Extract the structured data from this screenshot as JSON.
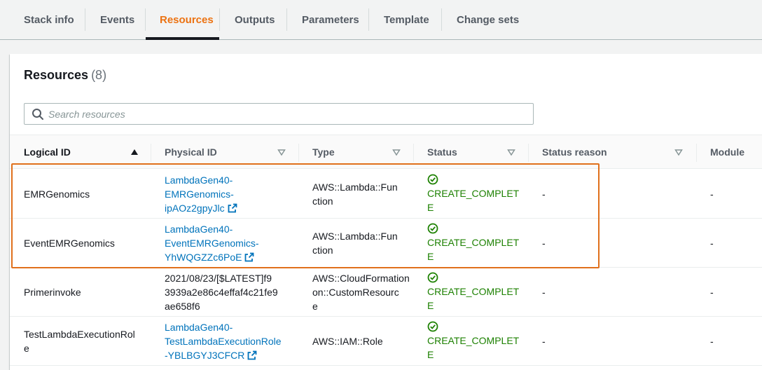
{
  "tabs": [
    "Stack info",
    "Events",
    "Resources",
    "Outputs",
    "Parameters",
    "Template",
    "Change sets"
  ],
  "active_tab": "Resources",
  "panel": {
    "title": "Resources",
    "count": "(8)"
  },
  "search": {
    "placeholder": "Search resources",
    "value": ""
  },
  "columns": [
    "Logical ID",
    "Physical ID",
    "Type",
    "Status",
    "Status reason",
    "Module"
  ],
  "sort": {
    "column": "Logical ID",
    "direction": "ascending"
  },
  "rows": [
    {
      "logical_id": "EMRGenomics",
      "physical_id_lines": [
        "LambdaGen40-",
        "EMRGenomics-",
        "ipAOz2gpyJlc"
      ],
      "physical_is_link": true,
      "type_lines": [
        "AWS::Lambda::Fun",
        "ction"
      ],
      "status_lines": [
        "CREATE_COMPLET",
        "E"
      ],
      "status_reason": "-",
      "module": "-"
    },
    {
      "logical_id": "EventEMRGenomics",
      "physical_id_lines": [
        "LambdaGen40-",
        "EventEMRGenomics-",
        "YhWQGZZc6PoE"
      ],
      "physical_is_link": true,
      "type_lines": [
        "AWS::Lambda::Fun",
        "ction"
      ],
      "status_lines": [
        "CREATE_COMPLET",
        "E"
      ],
      "status_reason": "-",
      "module": "-"
    },
    {
      "logical_id": "Primerinvoke",
      "physical_id_lines": [
        "2021/08/23/[$LATEST]f9",
        "3939a2e86c4effaf4c21fe9",
        "ae658f6"
      ],
      "physical_is_link": false,
      "type_lines": [
        "AWS::CloudFormation",
        "on::CustomResourc",
        "e"
      ],
      "status_lines": [
        "CREATE_COMPLET",
        "E"
      ],
      "status_reason": "-",
      "module": "-"
    },
    {
      "logical_id_lines": [
        "TestLambdaExecutionRol",
        "e"
      ],
      "physical_id_lines": [
        "LambdaGen40-",
        "TestLambdaExecutionRole",
        "-YBLBGYJ3CFCR"
      ],
      "physical_is_link": true,
      "type_lines": [
        "AWS::IAM::Role"
      ],
      "status_lines": [
        "CREATE_COMPLET",
        "E"
      ],
      "status_reason": "-",
      "module": "-"
    }
  ],
  "colors": {
    "active_tab": "#ec7211",
    "link": "#0073bb",
    "success": "#1d8102",
    "highlight_box": "#e0701c"
  },
  "icons": {
    "search": "search-icon",
    "sort_asc": "sort-ascending-icon",
    "sort": "sort-icon",
    "external": "external-link-icon",
    "status_ok": "check-circle-icon"
  }
}
